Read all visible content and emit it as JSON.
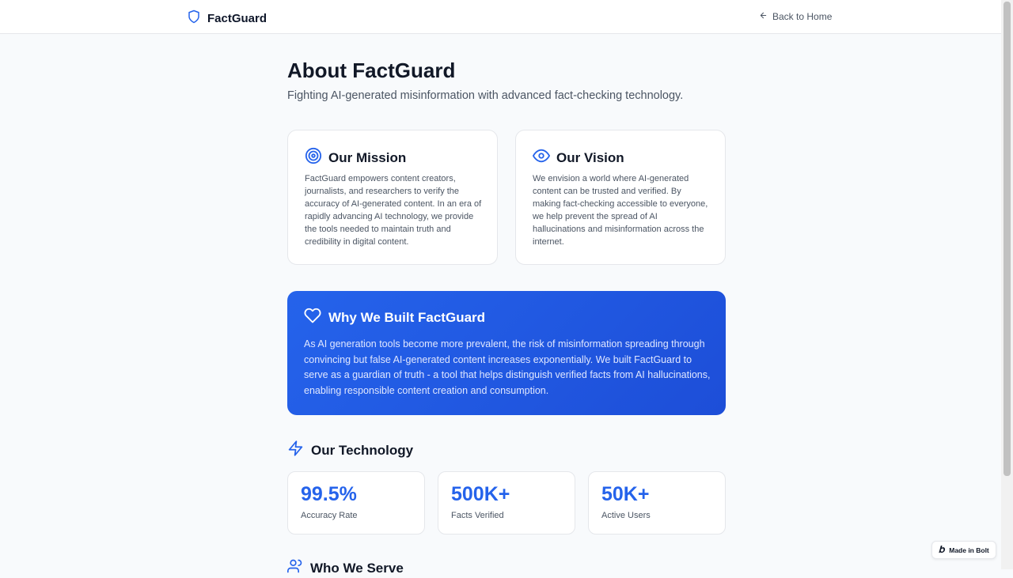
{
  "nav": {
    "brand": "FactGuard",
    "back_label": "Back to Home"
  },
  "page": {
    "title": "About FactGuard",
    "subtitle": "Fighting AI-generated misinformation with advanced fact-checking technology."
  },
  "mission": {
    "title": "Our Mission",
    "body": "FactGuard empowers content creators, journalists, and researchers to verify the accuracy of AI-generated content. In an era of rapidly advancing AI technology, we provide the tools needed to maintain truth and credibility in digital content."
  },
  "vision": {
    "title": "Our Vision",
    "body": "We envision a world where AI-generated content can be trusted and verified. By making fact-checking accessible to everyone, we help prevent the spread of AI hallucinations and misinformation across the internet."
  },
  "why": {
    "title": "Why We Built FactGuard",
    "body": "As AI generation tools become more prevalent, the risk of misinformation spreading through convincing but false AI-generated content increases exponentially. We built FactGuard to serve as a guardian of truth - a tool that helps distinguish verified facts from AI hallucinations, enabling responsible content creation and consumption."
  },
  "technology": {
    "title": "Our Technology",
    "stats": [
      {
        "value": "99.5%",
        "label": "Accuracy Rate"
      },
      {
        "value": "500K+",
        "label": "Facts Verified"
      },
      {
        "value": "50K+",
        "label": "Active Users"
      }
    ]
  },
  "serve": {
    "title": "Who We Serve"
  },
  "badge": {
    "label": "Made in Bolt"
  },
  "icons": {
    "brand": "shield-icon",
    "back": "arrow-left-icon",
    "mission": "target-icon",
    "vision": "eye-icon",
    "why": "heart-icon",
    "technology": "zap-icon",
    "serve": "users-icon",
    "badge": "bolt-logo-icon"
  },
  "colors": {
    "accent": "#2563eb",
    "accent_dark": "#1d4ed8",
    "text": "#111827",
    "muted": "#4b5563",
    "border": "#e5e7eb",
    "background": "#f8fafc"
  }
}
